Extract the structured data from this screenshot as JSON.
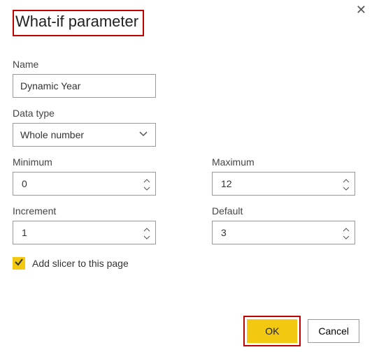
{
  "dialog": {
    "title": "What-if parameter",
    "close_glyph": "✕"
  },
  "fields": {
    "name": {
      "label": "Name",
      "value": "Dynamic Year"
    },
    "datatype": {
      "label": "Data type",
      "value": "Whole number"
    },
    "minimum": {
      "label": "Minimum",
      "value": "0"
    },
    "maximum": {
      "label": "Maximum",
      "value": "12"
    },
    "increment": {
      "label": "Increment",
      "value": "1"
    },
    "default": {
      "label": "Default",
      "value": "3"
    }
  },
  "checkbox": {
    "label": "Add slicer to this page",
    "checked": true
  },
  "buttons": {
    "ok": "OK",
    "cancel": "Cancel"
  },
  "colors": {
    "accent": "#F2C811",
    "highlight_border": "#c00000"
  }
}
